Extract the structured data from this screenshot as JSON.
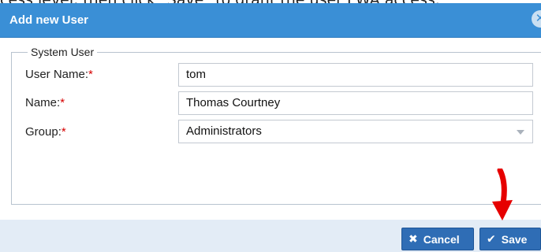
{
  "instruction_fragment": "cess level, then click \"Save\" to grant the user FWA access.",
  "dialog": {
    "title": "Add new User",
    "close_icon": "close-icon"
  },
  "fieldset": {
    "legend": "System User",
    "fields": [
      {
        "label": "User Name:",
        "required": "*",
        "value": "tom"
      },
      {
        "label": "Name:",
        "required": "*",
        "value": "Thomas Courtney"
      },
      {
        "label": "Group:",
        "required": "*",
        "value": "Administrators"
      }
    ]
  },
  "footer": {
    "cancel_label": "Cancel",
    "save_label": "Save"
  },
  "colors": {
    "header": "#3a8fd6",
    "button": "#2f6db5",
    "footer": "#e3ecf6",
    "required": "#d60000",
    "annotation_arrow": "#e60000"
  }
}
